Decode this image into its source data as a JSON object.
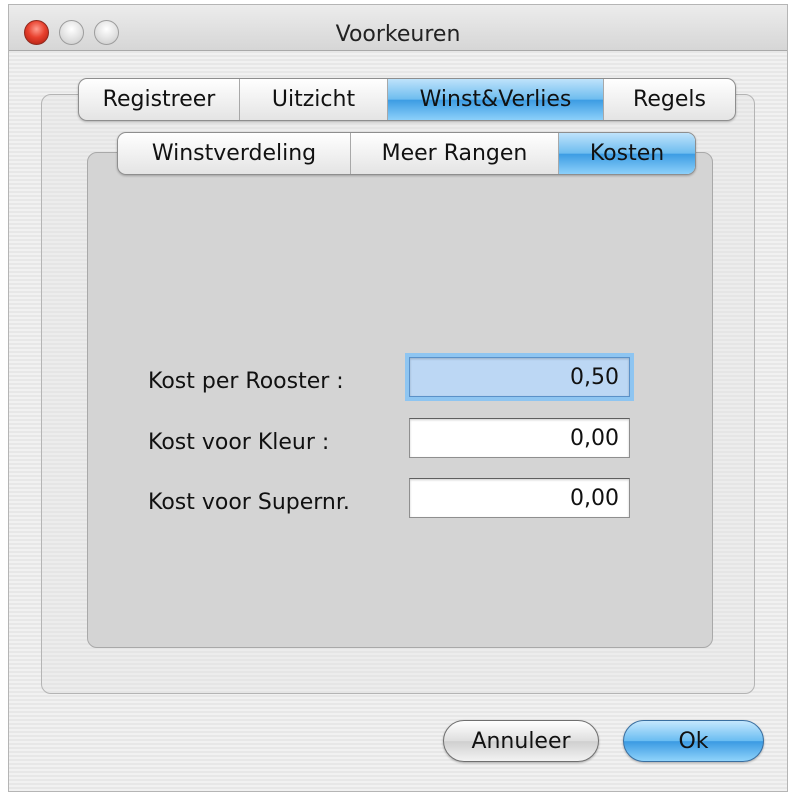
{
  "window": {
    "title": "Voorkeuren"
  },
  "tabs": {
    "main": [
      {
        "label": "Registreer",
        "active": false
      },
      {
        "label": "Uitzicht",
        "active": false
      },
      {
        "label": "Winst&Verlies",
        "active": true
      },
      {
        "label": "Regels",
        "active": false
      }
    ],
    "sub": [
      {
        "label": "Winstverdeling",
        "active": false
      },
      {
        "label": "Meer Rangen",
        "active": false
      },
      {
        "label": "Kosten",
        "active": true
      }
    ]
  },
  "form": {
    "cost_per_grid": {
      "label": "Kost per Rooster :",
      "value": "0,50"
    },
    "cost_color": {
      "label": "Kost voor Kleur :",
      "value": "0,00"
    },
    "cost_super": {
      "label": "Kost voor Supernr.",
      "value": "0,00"
    }
  },
  "buttons": {
    "cancel": "Annuleer",
    "ok": "Ok"
  },
  "colors": {
    "accent": "#4aa6e8",
    "close": "#e8412e"
  }
}
